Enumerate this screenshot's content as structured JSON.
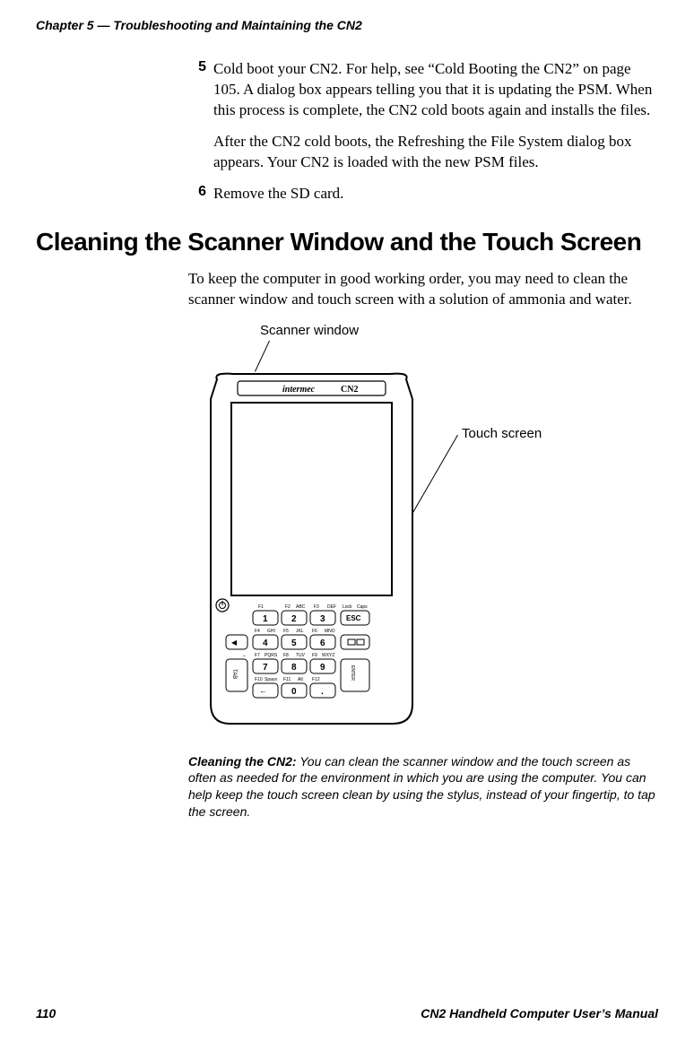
{
  "running_head": "Chapter 5 — Troubleshooting and Maintaining the CN2",
  "steps": {
    "s5": {
      "num": "5",
      "text": "Cold boot your CN2. For help, see “Cold Booting the CN2” on page 105. A dialog box appears telling you that it is updating the PSM. When this process is complete, the CN2 cold boots again and installs the files."
    },
    "s5_sub": "After the CN2 cold boots, the Refreshing the File System dialog box appears. Your CN2 is loaded with the new PSM files.",
    "s6": {
      "num": "6",
      "text": "Remove the SD card."
    }
  },
  "section_heading": "Cleaning the Scanner Window and the Touch Screen",
  "intro_para": "To keep the computer in good working order, you may need to clean the scanner window and touch screen with a solution of ammonia and water.",
  "figure": {
    "label_scanner": "Scanner window",
    "label_touch": "Touch screen",
    "brand": "intermec",
    "model": "CN2",
    "keys": {
      "row0": [
        "F1",
        "F2",
        "ABC",
        "F3",
        "DEF",
        "Lock",
        "Caps"
      ],
      "row1": [
        "1",
        "2",
        "3",
        "ESC"
      ],
      "row2_labels": [
        "F4",
        "GHI",
        "F5",
        "JKL",
        "F6",
        "MNO"
      ],
      "row2": [
        "4",
        "5",
        "6"
      ],
      "row3_labels": [
        "F7",
        "PQRS",
        "F8",
        "TUV",
        "F9",
        "WXYZ"
      ],
      "row3": [
        "7",
        "8",
        "9"
      ],
      "row4_labels": [
        "F10",
        "Space",
        "F11",
        "Alt",
        "F12"
      ],
      "row4": [
        "0",
        "."
      ],
      "tab": "TAB",
      "enter": "ENTER"
    }
  },
  "caption_strong": "Cleaning the CN2:",
  "caption_rest": " You can clean the scanner window and the touch screen as often as needed for the environment in which you are using the computer. You can help keep the touch screen clean by using the stylus, instead of your fingertip, to tap the screen.",
  "footer": {
    "page": "110",
    "title": "CN2 Handheld Computer User’s Manual"
  }
}
